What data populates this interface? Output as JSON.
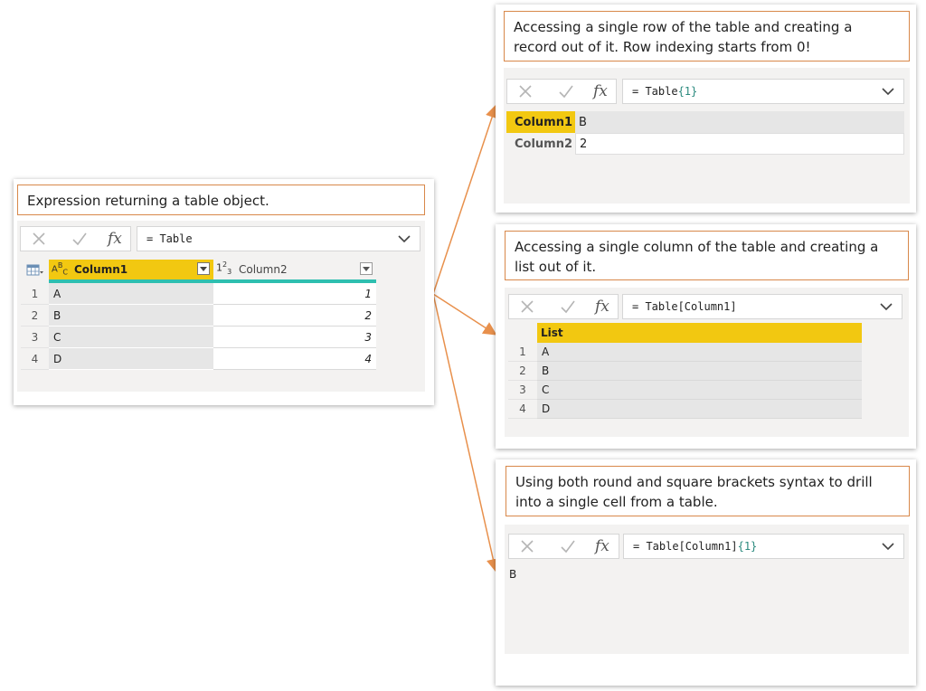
{
  "colors": {
    "accent_yellow": "#f2c811",
    "teal": "#2ebfb0",
    "orange_line": "#e8904c"
  },
  "icons": [
    "close-icon",
    "check-icon",
    "fx-icon",
    "chevron-down-icon",
    "table-icon",
    "type-abc-icon",
    "type-123-icon",
    "dropdown-icon"
  ],
  "panel_main": {
    "callout": "Expression returning a table object.",
    "formula": "= Table",
    "col1_type": "ABC",
    "col1_header": "Column1",
    "col2_type": "123",
    "col2_header": "Column2",
    "rows": [
      {
        "n": "1",
        "c1": "A",
        "c2": "1"
      },
      {
        "n": "2",
        "c1": "B",
        "c2": "2"
      },
      {
        "n": "3",
        "c1": "C",
        "c2": "3"
      },
      {
        "n": "4",
        "c1": "D",
        "c2": "4"
      }
    ]
  },
  "panel_record": {
    "callout": "Accessing a single row of the table and creating a record out of it. Row indexing starts from 0!",
    "formula_prefix": "= Table",
    "formula_index": "{1}",
    "fields": [
      {
        "name": "Column1",
        "value": "B"
      },
      {
        "name": "Column2",
        "value": "2"
      }
    ]
  },
  "panel_list": {
    "callout": "Accessing a single column of the table and creating a list out of it.",
    "formula": "= Table[Column1]",
    "header": "List",
    "rows": [
      {
        "n": "1",
        "v": "A"
      },
      {
        "n": "2",
        "v": "B"
      },
      {
        "n": "3",
        "v": "C"
      },
      {
        "n": "4",
        "v": "D"
      }
    ]
  },
  "panel_cell": {
    "callout": "Using both round and square brackets syntax to drill into a single cell from a table.",
    "formula_prefix": "= Table[Column1]",
    "formula_index": "{1}",
    "result": "B"
  }
}
